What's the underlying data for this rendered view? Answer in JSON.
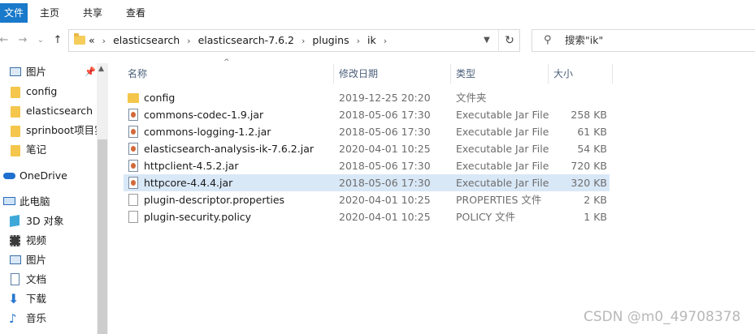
{
  "ribbon": {
    "file": "文件",
    "home": "主页",
    "share": "共享",
    "view": "查看"
  },
  "nav_buttons": {
    "back": "←",
    "forward": "→",
    "recent": "⌄",
    "up": "↑"
  },
  "address": {
    "overflow": "«",
    "crumbs": [
      "elasticsearch",
      "elasticsearch-7.6.2",
      "plugins",
      "ik"
    ],
    "sep": "›"
  },
  "search": {
    "placeholder": "搜索\"ik\""
  },
  "nav_items": [
    {
      "label": "图片",
      "icon": "pictures-icon",
      "pinned": true
    },
    {
      "label": "config",
      "icon": "folder-icon"
    },
    {
      "label": "elasticsearch",
      "icon": "folder-icon"
    },
    {
      "label": "sprinboot项目实",
      "icon": "folder-icon"
    },
    {
      "label": "笔记",
      "icon": "folder-icon"
    },
    {
      "label": "OneDrive",
      "icon": "cloud-icon"
    },
    {
      "label": "此电脑",
      "icon": "computer-icon"
    },
    {
      "label": "3D 对象",
      "icon": "3d-objects-icon"
    },
    {
      "label": "视频",
      "icon": "videos-icon"
    },
    {
      "label": "图片",
      "icon": "pictures-icon"
    },
    {
      "label": "文档",
      "icon": "documents-icon"
    },
    {
      "label": "下载",
      "icon": "downloads-icon"
    },
    {
      "label": "音乐",
      "icon": "music-icon"
    }
  ],
  "columns": {
    "name": "名称",
    "date": "修改日期",
    "type": "类型",
    "size": "大小"
  },
  "files": [
    {
      "name": "config",
      "date": "2019-12-25 20:20",
      "type": "文件夹",
      "size": "",
      "icon": "folder"
    },
    {
      "name": "commons-codec-1.9.jar",
      "date": "2018-05-06 17:30",
      "type": "Executable Jar File",
      "size": "258 KB",
      "icon": "jar"
    },
    {
      "name": "commons-logging-1.2.jar",
      "date": "2018-05-06 17:30",
      "type": "Executable Jar File",
      "size": "61 KB",
      "icon": "jar"
    },
    {
      "name": "elasticsearch-analysis-ik-7.6.2.jar",
      "date": "2020-04-01 10:25",
      "type": "Executable Jar File",
      "size": "54 KB",
      "icon": "jar"
    },
    {
      "name": "httpclient-4.5.2.jar",
      "date": "2018-05-06 17:30",
      "type": "Executable Jar File",
      "size": "720 KB",
      "icon": "jar"
    },
    {
      "name": "httpcore-4.4.4.jar",
      "date": "2018-05-06 17:30",
      "type": "Executable Jar File",
      "size": "320 KB",
      "icon": "jar",
      "selected": true
    },
    {
      "name": "plugin-descriptor.properties",
      "date": "2020-04-01 10:25",
      "type": "PROPERTIES 文件",
      "size": "2 KB",
      "icon": "doc"
    },
    {
      "name": "plugin-security.policy",
      "date": "2020-04-01 10:25",
      "type": "POLICY 文件",
      "size": "1 KB",
      "icon": "doc"
    }
  ],
  "watermark": "CSDN @m0_49708378",
  "colors": {
    "accent": "#1979ca",
    "selection": "#d9e8f7",
    "folder": "#f4c64b"
  }
}
